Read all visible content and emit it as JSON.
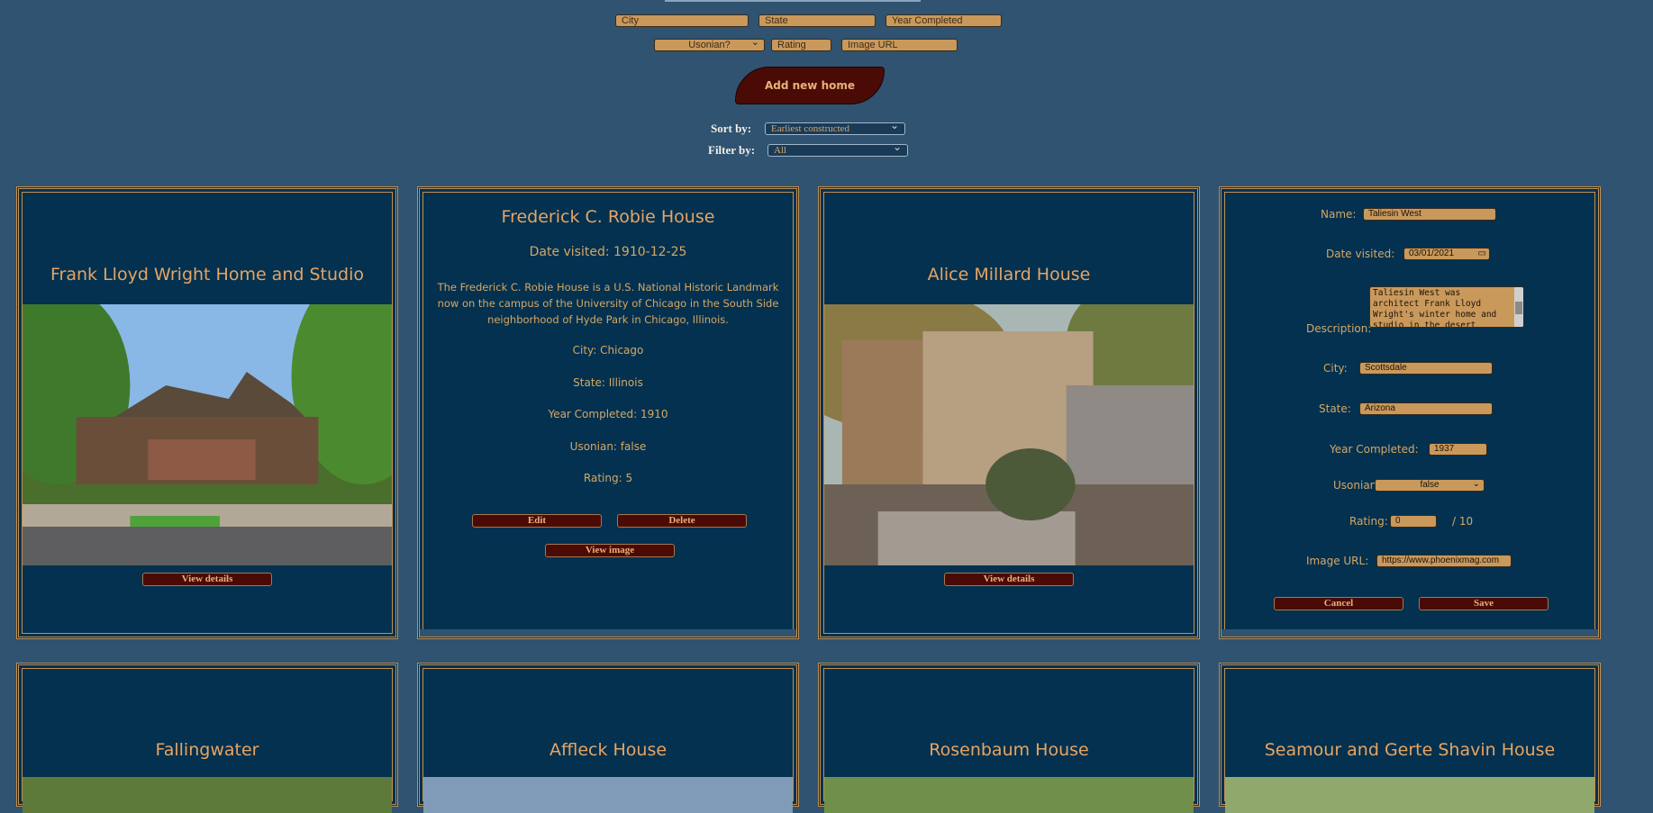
{
  "form": {
    "city_placeholder": "City",
    "state_placeholder": "State",
    "year_placeholder": "Year Completed",
    "usonian_placeholder": "Usonian?",
    "rating_placeholder": "Rating",
    "image_placeholder": "Image URL",
    "add_button": "Add new home"
  },
  "controls": {
    "sort_label": "Sort by:",
    "sort_value": "Earliest constructed",
    "filter_label": "Filter by:",
    "filter_value": "All"
  },
  "cards": [
    {
      "title": "Frank Lloyd Wright Home and Studio",
      "button": "View details"
    },
    {
      "title": "Frederick C. Robie House",
      "date": "Date visited: 1910-12-25",
      "description": "The Frederick C. Robie House is a U.S. National Historic Landmark now on the campus of the University of Chicago in the South Side neighborhood of Hyde Park in Chicago, Illinois.",
      "city": "City: Chicago",
      "state": "State: Illinois",
      "year": "Year Completed: 1910",
      "usonian": "Usonian: false",
      "rating": "Rating: 5",
      "edit_button": "Edit",
      "delete_button": "Delete",
      "view_image_button": "View image"
    },
    {
      "title": "Alice Millard House",
      "button": "View details"
    },
    {
      "name_label": "Name:",
      "name_value": "Taliesin West",
      "date_label": "Date visited:",
      "date_value": "03/01/2021",
      "desc_label": "Description:",
      "desc_value": "Taliesin West was architect Frank Lloyd Wright's winter home and studio in the desert",
      "city_label": "City:",
      "city_value": "Scottsdale",
      "state_label": "State:",
      "state_value": "Arizona",
      "year_label": "Year Completed:",
      "year_value": "1937",
      "usonian_label": "Usonian:",
      "usonian_value": "false",
      "rating_label": "Rating:",
      "rating_value": "0",
      "rating_suffix": "/ 10",
      "image_label": "Image URL:",
      "image_value": "https://www.phoenixmag.com",
      "cancel_button": "Cancel",
      "save_button": "Save"
    }
  ],
  "row2_titles": [
    "Fallingwater",
    "Affleck House",
    "Rosenbaum House",
    "Seamour and Gerte Shavin House"
  ]
}
